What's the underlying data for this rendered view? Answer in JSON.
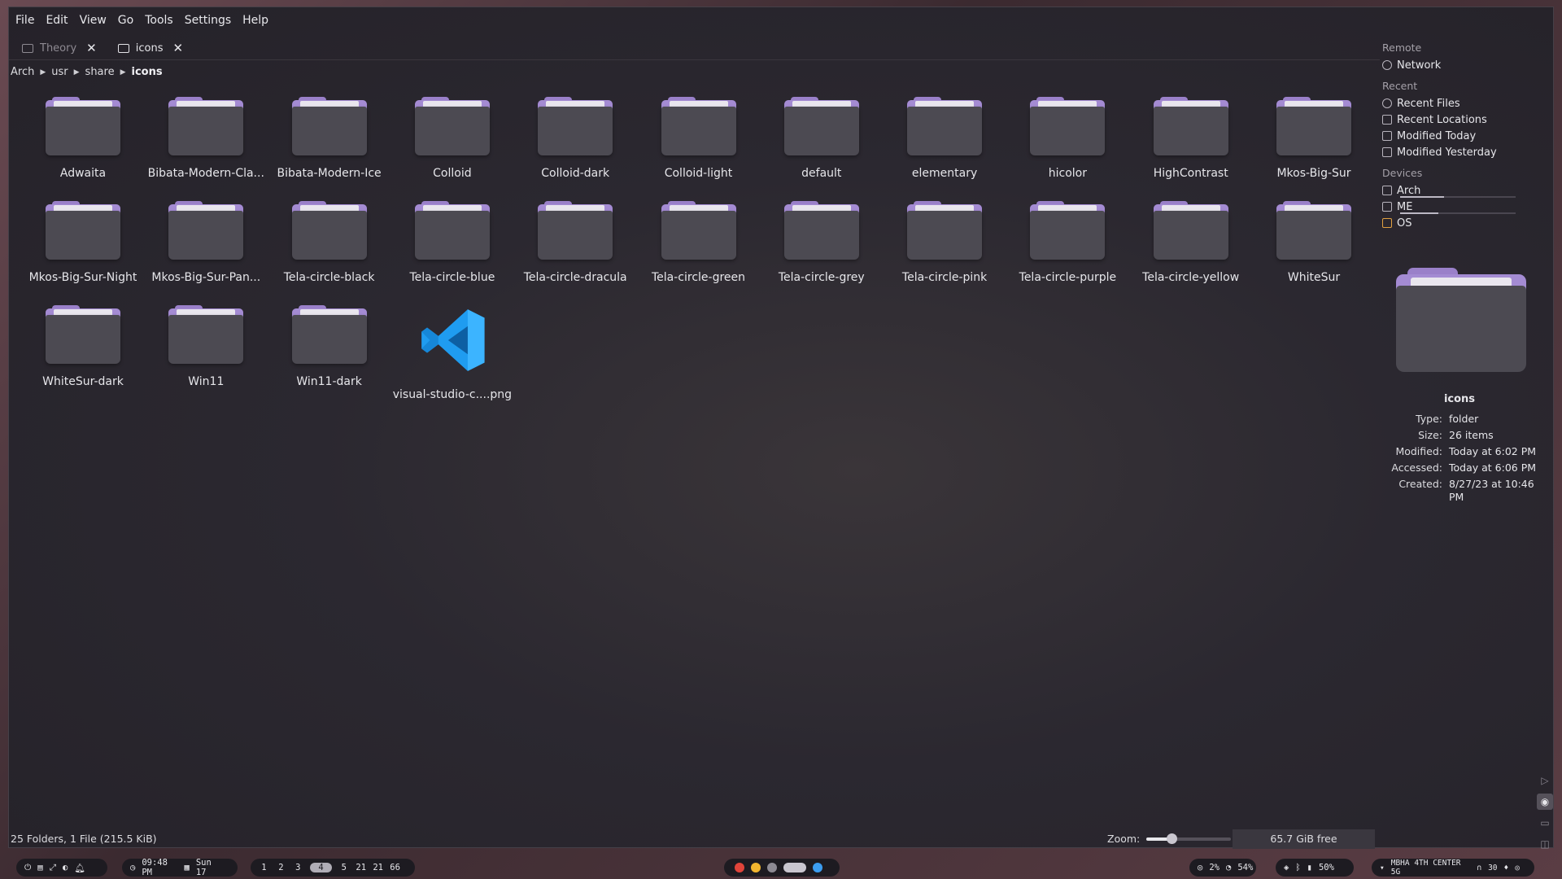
{
  "menu": [
    "File",
    "Edit",
    "View",
    "Go",
    "Tools",
    "Settings",
    "Help"
  ],
  "tabs": [
    {
      "label": "Theory",
      "active": false
    },
    {
      "label": "icons",
      "active": true
    }
  ],
  "breadcrumb": [
    "Arch",
    "usr",
    "share",
    "icons"
  ],
  "items": [
    {
      "label": "Adwaita",
      "type": "folder"
    },
    {
      "label": "Bibata-Modern-Cla...",
      "type": "folder"
    },
    {
      "label": "Bibata-Modern-Ice",
      "type": "folder"
    },
    {
      "label": "Colloid",
      "type": "folder"
    },
    {
      "label": "Colloid-dark",
      "type": "folder"
    },
    {
      "label": "Colloid-light",
      "type": "folder"
    },
    {
      "label": "default",
      "type": "folder"
    },
    {
      "label": "elementary",
      "type": "folder"
    },
    {
      "label": "hicolor",
      "type": "folder"
    },
    {
      "label": "HighContrast",
      "type": "folder"
    },
    {
      "label": "Mkos-Big-Sur",
      "type": "folder"
    },
    {
      "label": "Mkos-Big-Sur-Night",
      "type": "folder"
    },
    {
      "label": "Mkos-Big-Sur-Pan...",
      "type": "folder"
    },
    {
      "label": "Tela-circle-black",
      "type": "folder"
    },
    {
      "label": "Tela-circle-blue",
      "type": "folder"
    },
    {
      "label": "Tela-circle-dracula",
      "type": "folder"
    },
    {
      "label": "Tela-circle-green",
      "type": "folder"
    },
    {
      "label": "Tela-circle-grey",
      "type": "folder"
    },
    {
      "label": "Tela-circle-pink",
      "type": "folder"
    },
    {
      "label": "Tela-circle-purple",
      "type": "folder"
    },
    {
      "label": "Tela-circle-yellow",
      "type": "folder"
    },
    {
      "label": "WhiteSur",
      "type": "folder"
    },
    {
      "label": "WhiteSur-dark",
      "type": "folder"
    },
    {
      "label": "Win11",
      "type": "folder"
    },
    {
      "label": "Win11-dark",
      "type": "folder"
    },
    {
      "label": "visual-studio-c....png",
      "type": "vscode-image"
    }
  ],
  "status": {
    "summary": "25 Folders, 1 File (215.5 KiB)",
    "zoom_label": "Zoom:",
    "zoom_level": 0.3,
    "free": "65.7 GiB free"
  },
  "sidebar": {
    "remote_header": "Remote",
    "network": "Network",
    "recent_header": "Recent",
    "recent_files": "Recent Files",
    "recent_locations": "Recent Locations",
    "modified_today": "Modified Today",
    "modified_yesterday": "Modified Yesterday",
    "devices_header": "Devices",
    "devices": [
      {
        "label": "Arch",
        "usage": 0.38
      },
      {
        "label": "ME",
        "usage": 0.33
      },
      {
        "label": "OS",
        "usage": null
      }
    ]
  },
  "info": {
    "title": "icons",
    "type_k": "Type:",
    "type_v": "folder",
    "size_k": "Size:",
    "size_v": "26 items",
    "modified_k": "Modified:",
    "modified_v": "Today at 6:02 PM",
    "accessed_k": "Accessed:",
    "accessed_v": "Today at 6:06 PM",
    "created_k": "Created:",
    "created_v": "8/27/23 at 10:46 PM"
  },
  "taskbar": {
    "clock": "09:48 PM",
    "date": "Sun 17",
    "workspaces": [
      "1",
      "2",
      "3",
      "4",
      "5",
      "21",
      "21",
      "66"
    ],
    "active_workspace": 3,
    "cpu": "2%",
    "mem": "54%",
    "battery": "50%",
    "wifi": "MBHA 4TH CENTER 5G",
    "volume": "30"
  },
  "colors": {
    "folder_tab": "#a48bd3",
    "folder_body": "#4c4a52",
    "vscode_blue": "#1f9cf0"
  }
}
